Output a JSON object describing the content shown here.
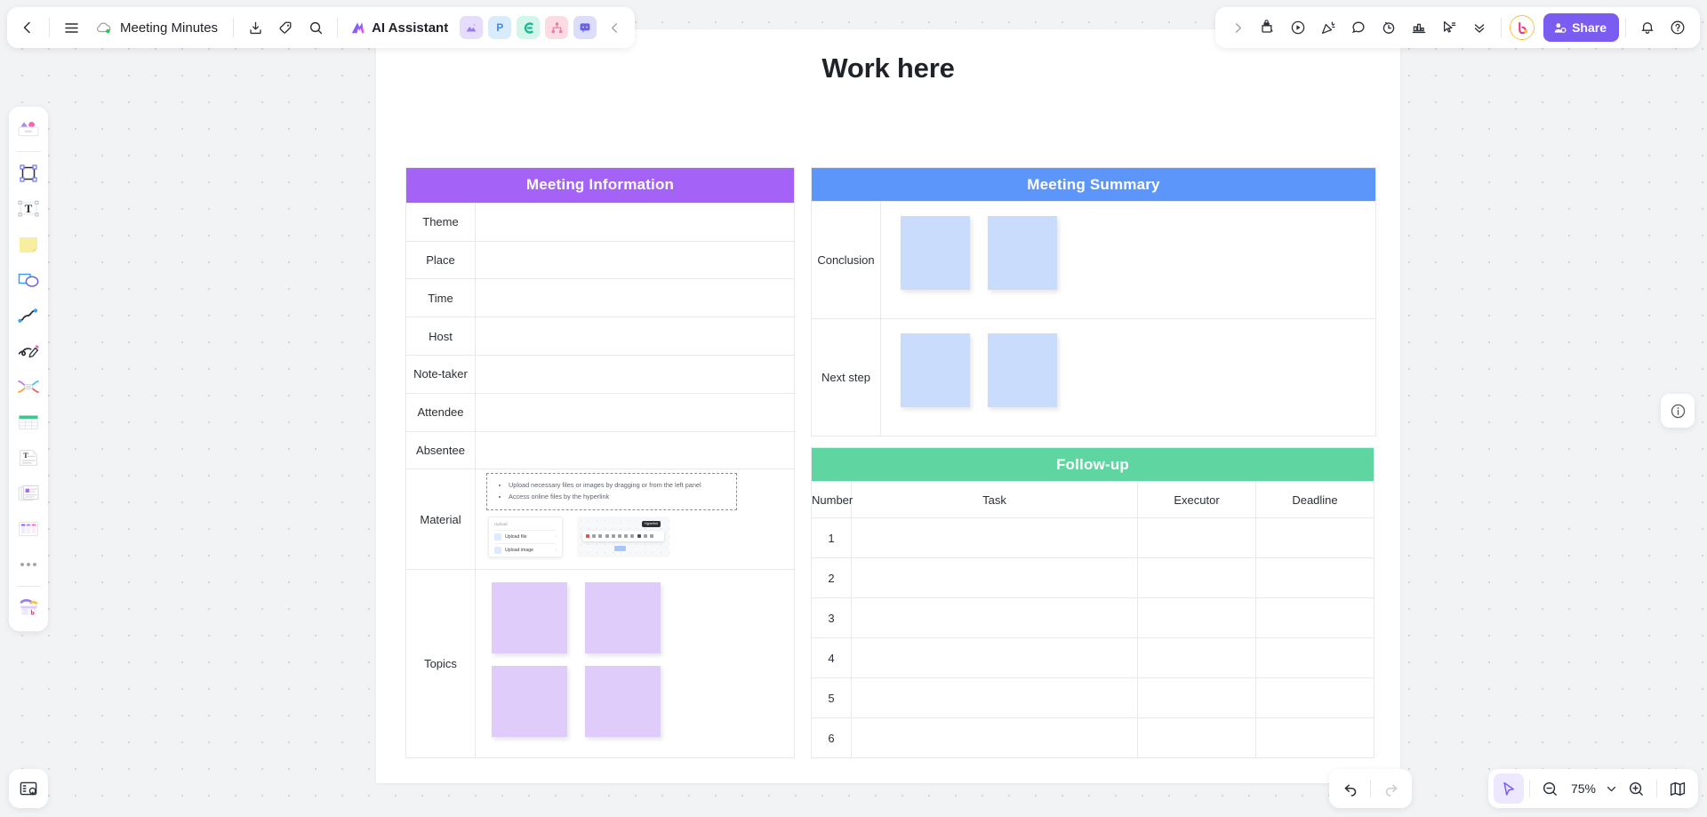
{
  "app": {
    "doc_title": "Meeting Minutes",
    "ai_assistant_label": "AI Assistant",
    "share_label": "Share",
    "canvas_title": "Work here",
    "zoom_level": "75%",
    "accent_color": "#7b5cf0"
  },
  "toolbar_left": {
    "back_icon": "chevron-left-icon",
    "menu_icon": "hamburger-menu-icon",
    "cloud_icon": "cloud-sync-icon",
    "export_icon": "export-download-icon",
    "tag_icon": "tag-icon",
    "search_icon": "search-icon",
    "collapse_icon": "chevron-left-icon",
    "app_chips": [
      {
        "name": "image-app-chip",
        "glyph": "◢",
        "bg": "#e6dcfb",
        "fg": "#9a7bf0"
      },
      {
        "name": "presentation-app-chip",
        "glyph": "P",
        "bg": "#d8ecfd",
        "fg": "#3a8ef0"
      },
      {
        "name": "mindmap-app-chip",
        "glyph": "C",
        "bg": "#d3f5ea",
        "fg": "#16b79a"
      },
      {
        "name": "flowchart-app-chip",
        "glyph": "⑂",
        "bg": "#fcdce4",
        "fg": "#ef7a9b"
      },
      {
        "name": "comment-app-chip",
        "glyph": "■",
        "bg": "#dcdcfb",
        "fg": "#6a62ee"
      }
    ]
  },
  "toolbar_right": {
    "expand_icon": "chevron-right-icon",
    "icons": [
      "sticky-note-lock-icon",
      "play-circle-icon",
      "celebrate-icon",
      "comment-bubble-icon",
      "timer-icon",
      "vote-chart-icon",
      "cursor-list-icon",
      "chevron-double-down-icon"
    ],
    "avatar_name": "user-avatar",
    "notification_icon": "bell-icon",
    "help_icon": "help-circle-icon"
  },
  "left_rail": {
    "items": [
      {
        "name": "sidebar-item-templates",
        "label": "Templates"
      },
      {
        "name": "sidebar-item-frame",
        "label": "Frame"
      },
      {
        "name": "sidebar-item-text",
        "label": "Text"
      },
      {
        "name": "sidebar-item-sticky-note",
        "label": "Sticky note"
      },
      {
        "name": "sidebar-item-shape",
        "label": "Shape"
      },
      {
        "name": "sidebar-item-connector",
        "label": "Connector"
      },
      {
        "name": "sidebar-item-pen",
        "label": "Pen"
      },
      {
        "name": "sidebar-item-mindmap",
        "label": "Mind map"
      },
      {
        "name": "sidebar-item-table",
        "label": "Table"
      },
      {
        "name": "sidebar-item-doc",
        "label": "Doc"
      },
      {
        "name": "sidebar-item-media",
        "label": "Media"
      },
      {
        "name": "sidebar-item-kanban",
        "label": "Kanban"
      },
      {
        "name": "sidebar-item-more",
        "label": "More"
      },
      {
        "name": "sidebar-item-upload",
        "label": "Upload"
      }
    ],
    "bottom_button": "layers-panel-icon"
  },
  "right_panel": {
    "info_icon": "info-circle-icon"
  },
  "bottom_bar": {
    "undo_icon": "undo-icon",
    "redo_icon": "redo-icon",
    "cursor_icon": "cursor-select-icon",
    "zoom_out_icon": "zoom-out-icon",
    "zoom_in_icon": "zoom-in-icon",
    "zoom_dropdown_icon": "chevron-down-icon",
    "minimap_icon": "minimap-icon"
  },
  "meeting_information": {
    "header": "Meeting Information",
    "header_color": "#a562f7",
    "rows": [
      {
        "label": "Theme",
        "value": ""
      },
      {
        "label": "Place",
        "value": ""
      },
      {
        "label": "Time",
        "value": ""
      },
      {
        "label": "Host",
        "value": ""
      },
      {
        "label": "Note-taker",
        "value": ""
      },
      {
        "label": "Attendee",
        "value": ""
      },
      {
        "label": "Absentee",
        "value": ""
      }
    ],
    "material_label": "Material",
    "material_hints": [
      "Upload necessary files or images by dragging or from the left panel",
      "Access online files by the hyperlink"
    ],
    "mini_upload": {
      "title": "Upload",
      "options": [
        "Upload file",
        "Upload image"
      ]
    },
    "mini_toolbar": {
      "tooltip": "Hyperlink"
    },
    "topics_label": "Topics",
    "topics_notes": [
      "",
      "",
      "",
      ""
    ]
  },
  "meeting_summary": {
    "header": "Meeting Summary",
    "header_color": "#5c96fb",
    "rows": [
      {
        "label": "Conclusion",
        "notes": [
          "",
          ""
        ]
      },
      {
        "label": "Next step",
        "notes": [
          "",
          ""
        ]
      }
    ]
  },
  "follow_up": {
    "header": "Follow-up",
    "header_color": "#5fd6a1",
    "columns": [
      "Number",
      "Task",
      "Executor",
      "Deadline"
    ],
    "rows": [
      {
        "number": "1",
        "task": "",
        "executor": "",
        "deadline": ""
      },
      {
        "number": "2",
        "task": "",
        "executor": "",
        "deadline": ""
      },
      {
        "number": "3",
        "task": "",
        "executor": "",
        "deadline": ""
      },
      {
        "number": "4",
        "task": "",
        "executor": "",
        "deadline": ""
      },
      {
        "number": "5",
        "task": "",
        "executor": "",
        "deadline": ""
      },
      {
        "number": "6",
        "task": "",
        "executor": "",
        "deadline": ""
      }
    ]
  }
}
